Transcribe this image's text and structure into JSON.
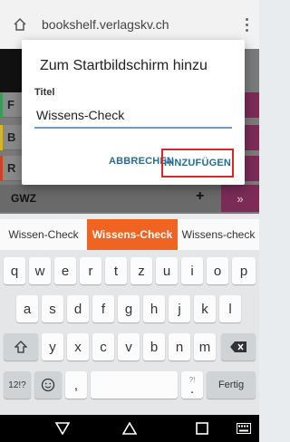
{
  "browser": {
    "url": "bookshelf.verlagskv.ch"
  },
  "background_page": {
    "rows": [
      {
        "letter": "F",
        "stripe": "#3f9a5a"
      },
      {
        "letter": "B",
        "stripe": "#d7b52a"
      },
      {
        "letter": "R",
        "stripe": "#c8452b"
      }
    ],
    "gwz_label": "GWZ",
    "gwz_plus": "+",
    "gwz_icon": "»"
  },
  "dialog": {
    "title": "Zum Startbildschirm hinzu",
    "field_label": "Titel",
    "field_value": "Wissens-Check",
    "cancel_label": "ABBRECHEN",
    "add_label": "HINZUFÜGEN"
  },
  "suggestions": [
    "Wissen-Check",
    "Wissens-Check",
    "Wissens-check"
  ],
  "keyboard": {
    "row1": [
      "q",
      "w",
      "e",
      "r",
      "t",
      "z",
      "u",
      "i",
      "o",
      "p"
    ],
    "row2": [
      "a",
      "s",
      "d",
      "f",
      "g",
      "h",
      "j",
      "k",
      "l"
    ],
    "row3": [
      "y",
      "x",
      "c",
      "v",
      "b",
      "n",
      "m"
    ],
    "num_label": "12!?",
    "comma": ",",
    "period": ".",
    "period_alt": "?!",
    "done_label": "Fertig"
  },
  "colors": {
    "accent_orange": "#f06423",
    "dialog_button": "#2a6c8f",
    "highlight_box": "#d8262c"
  }
}
